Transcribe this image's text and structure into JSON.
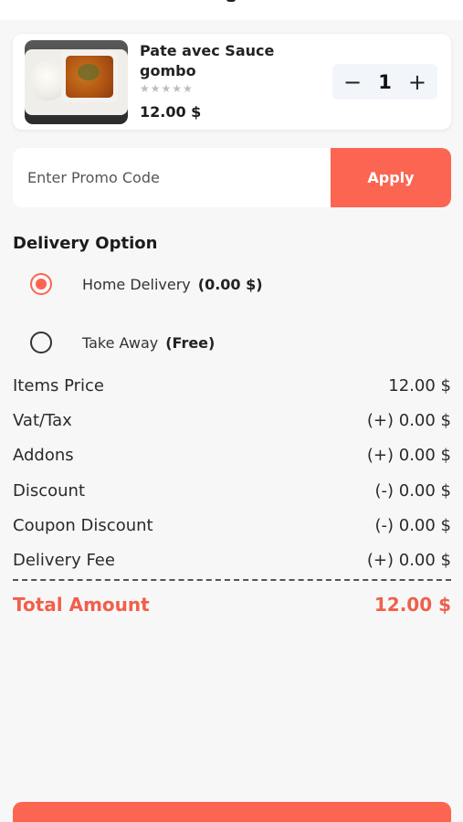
{
  "cart": {
    "item": {
      "name": "Pate avec Sauce gombo",
      "rating_stars": "★★★★★",
      "price": "12.00 $",
      "quantity": "1",
      "decrement_label": "−",
      "increment_label": "+"
    }
  },
  "promo": {
    "placeholder": "Enter Promo Code",
    "value": "",
    "apply_label": "Apply"
  },
  "delivery": {
    "title": "Delivery Option",
    "options": [
      {
        "label": "Home Delivery",
        "extra": "(0.00 $)",
        "selected": true
      },
      {
        "label": "Take Away",
        "extra": "(Free)",
        "selected": false
      }
    ]
  },
  "summary": {
    "rows": [
      {
        "label": "Items Price",
        "value": "12.00 $"
      },
      {
        "label": "Vat/Tax",
        "value": "(+) 0.00 $"
      },
      {
        "label": "Addons",
        "value": "(+) 0.00 $"
      },
      {
        "label": "Discount",
        "value": "(-) 0.00 $"
      },
      {
        "label": "Coupon Discount",
        "value": "(-) 0.00 $"
      },
      {
        "label": "Delivery Fee",
        "value": "(+) 0.00 $"
      }
    ],
    "total_label": "Total Amount",
    "total_value": "12.00 $"
  },
  "colors": {
    "accent": "#fb6551",
    "total_text": "#f05f4a",
    "background": "#f7f7f7"
  }
}
